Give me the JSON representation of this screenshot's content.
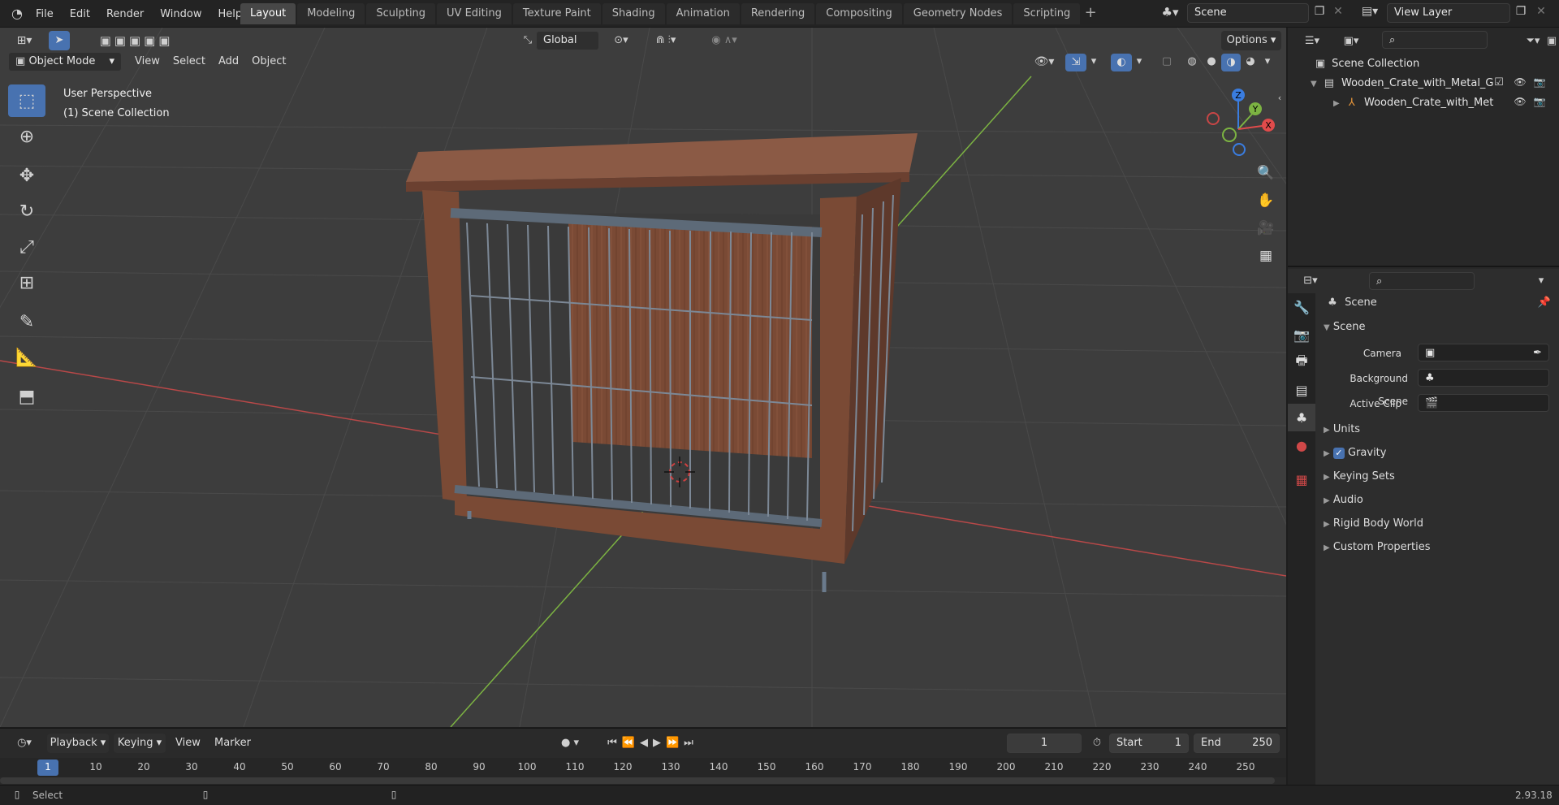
{
  "topbar": {
    "menu": [
      "File",
      "Edit",
      "Render",
      "Window",
      "Help"
    ],
    "workspace_tabs": [
      "Layout",
      "Modeling",
      "Sculpting",
      "UV Editing",
      "Texture Paint",
      "Shading",
      "Animation",
      "Rendering",
      "Compositing",
      "Geometry Nodes",
      "Scripting"
    ],
    "active_tab": "Layout",
    "scene_name": "Scene",
    "view_layer": "View Layer"
  },
  "viewport": {
    "orientation": "Global",
    "options_label": "Options",
    "mode": "Object Mode",
    "menu": [
      "View",
      "Select",
      "Add",
      "Object"
    ],
    "overlay_line1": "User Perspective",
    "overlay_line2": "(1) Scene Collection",
    "axis_labels": {
      "z": "Z",
      "y": "Y",
      "x": "X"
    }
  },
  "outliner": {
    "root": "Scene Collection",
    "collection": "Wooden_Crate_with_Metal_G",
    "object": "Wooden_Crate_with_Met"
  },
  "properties": {
    "context_title": "Scene",
    "panel_title": "Scene",
    "camera_label": "Camera",
    "background_scene_label": "Background Scene",
    "active_clip_label": "Active Clip",
    "panels": [
      "Units",
      "Gravity",
      "Keying Sets",
      "Audio",
      "Rigid Body World",
      "Custom Properties"
    ],
    "gravity_checked": true
  },
  "timeline": {
    "menu": [
      "Playback",
      "Keying",
      "View",
      "Marker"
    ],
    "current_frame": "1",
    "start_label": "Start",
    "start_value": "1",
    "end_label": "End",
    "end_value": "250",
    "frame_ticks": [
      "1",
      "10",
      "20",
      "30",
      "40",
      "50",
      "60",
      "70",
      "80",
      "90",
      "100",
      "110",
      "120",
      "130",
      "140",
      "150",
      "160",
      "170",
      "180",
      "190",
      "200",
      "210",
      "220",
      "230",
      "240",
      "250"
    ]
  },
  "statusbar": {
    "select_label": "Select",
    "version": "2.93.18"
  },
  "colors": {
    "accent_blue": "#4872b0",
    "axis_x": "#c84646",
    "axis_y": "#7cb342",
    "wood": "#7a4a35",
    "metal": "#5d6a78"
  }
}
